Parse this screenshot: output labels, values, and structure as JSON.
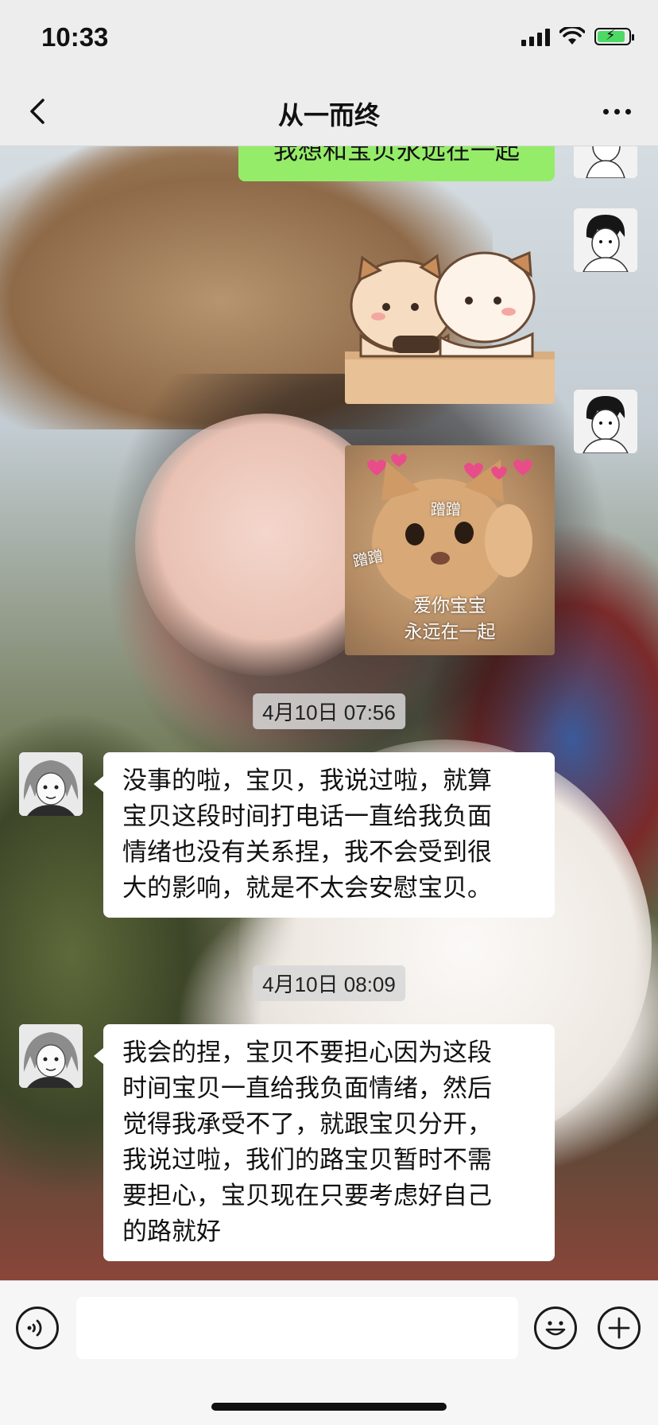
{
  "status_bar": {
    "time": "10:33"
  },
  "nav": {
    "title": "从一而终"
  },
  "messages": [
    {
      "from": "me",
      "type": "text",
      "text": "我想和宝贝永远在一起"
    },
    {
      "from": "me",
      "type": "sticker",
      "name": "bear-hug-sticker"
    },
    {
      "from": "me",
      "type": "sticker",
      "name": "cat-love-sticker",
      "tag1": "蹭蹭",
      "tag2": "蹭蹭",
      "caption_line1": "爱你宝宝",
      "caption_line2": "永远在一起"
    },
    {
      "type": "timestamp",
      "text": "4月10日 07:56"
    },
    {
      "from": "other",
      "type": "text",
      "lines": [
        "没事的啦，宝贝，我说过啦，就算",
        "宝贝这段时间打电话一直给我负面",
        "情绪也没有关系捏，我不会受到很",
        "大的影响，就是不太会安慰宝贝。"
      ]
    },
    {
      "type": "timestamp",
      "text": "4月10日 08:09"
    },
    {
      "from": "other",
      "type": "text",
      "lines": [
        "我会的捏，宝贝不要担心因为这段",
        "时间宝贝一直给我负面情绪，然后",
        "觉得我承受不了，就跟宝贝分开，",
        "我说过啦，我们的路宝贝暂时不需",
        "要担心，宝贝现在只要考虑好自己",
        "的路就好"
      ]
    }
  ],
  "input": {
    "value": ""
  },
  "icons": {
    "back": "chevron-left-icon",
    "more": "more-dots-icon",
    "voice": "voice-icon",
    "emoji": "emoji-icon",
    "plus": "plus-icon"
  },
  "colors": {
    "my_bubble": "#95ec69",
    "other_bubble": "#ffffff",
    "bar_bg": "#ededed"
  }
}
